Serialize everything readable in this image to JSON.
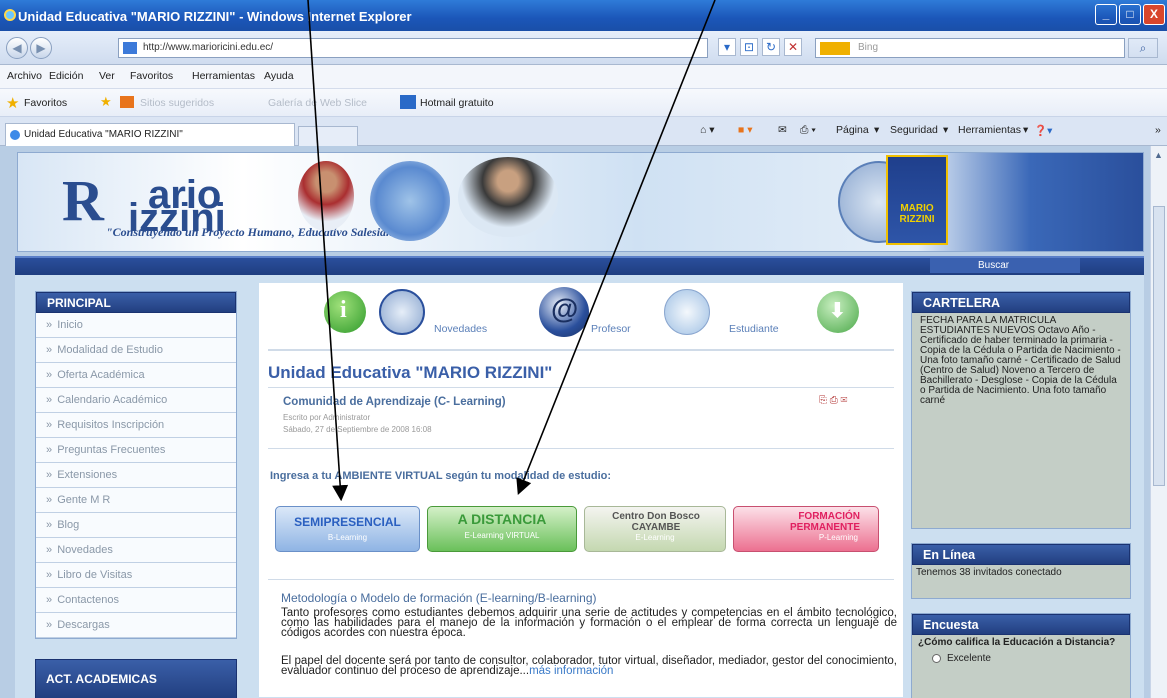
{
  "window": {
    "title": "Unidad Educativa \"MARIO RIZZINI\" - Windows Internet Explorer",
    "minimize": "_",
    "maximize": "□",
    "close": "X"
  },
  "address_bar": {
    "url": "http://www.marioricini.edu.ec/",
    "search_placeholder": "Bing"
  },
  "menu": [
    "Archivo",
    "Edición",
    "Ver",
    "Favoritos",
    "Herramientas",
    "Ayuda"
  ],
  "favorites_bar": {
    "favoritos": "Favoritos",
    "sitios": "Sitios sugeridos",
    "galeria": "Galería de Web Slice",
    "hotmail": "Hotmail gratuito"
  },
  "tab": {
    "title": "Unidad Educativa \"MARIO RIZZINI\""
  },
  "commands": {
    "pagina": "Página",
    "seguridad": "Seguridad",
    "herramientas": "Herramientas"
  },
  "banner": {
    "logo_r": "R",
    "logo_mario": "ario",
    "logo_izzini": "izzini",
    "slogan": "\"Construyendo un Proyecto Humano, Educativo Salesiano\"",
    "shield_text": "MARIO RIZZINI"
  },
  "nav": {
    "buscar": "Buscar"
  },
  "left_menu": {
    "header": "PRINCIPAL",
    "items": [
      "Inicio",
      "Modalidad de Estudio",
      "Oferta Académica",
      "Calendario Académico",
      "Requisitos Inscripción",
      "Preguntas Frecuentes",
      "Extensiones",
      "Gente M R",
      "Blog",
      "Novedades",
      "Libro de Visitas",
      "Contactenos",
      "Descargas"
    ],
    "act_header": "ACT. ACADEMICAS"
  },
  "top_icons": {
    "novedades": "Novedades",
    "profesor": "Profesor",
    "estudiante": "Estudiante"
  },
  "article": {
    "title": "Unidad Educativa \"MARIO RIZZINI\"",
    "subtitle": "Comunidad de Aprendizaje (C- Learning)",
    "author": "Escrito por Administrator",
    "date": "Sábado, 27 de Septiembre de 2008 16:08",
    "ingresa": "Ingresa a tu AMBIENTE VIRTUAL según tu modalidad de estudio:",
    "modalidades": [
      {
        "label": "SEMIPRESENCIAL",
        "sub": "B-Learning"
      },
      {
        "label": "A DISTANCIA",
        "sub": "E-Learning VIRTUAL"
      },
      {
        "label": "Centro Don Bosco CAYAMBE",
        "sub": "E-Learning"
      },
      {
        "label": "FORMACIÓN PERMANENTE",
        "sub": "P-Learning"
      }
    ],
    "metodologia": "Metodología o Modelo de formación (E-learning/B-learning)",
    "para1": "Tanto profesores como estudiantes debemos adquirir una serie de actitudes y competencias en el ámbito tecnológico, como las habilidades para el manejo de la información y formación o el emplear de forma correcta un lenguaje de códigos acordes con nuestra época.",
    "para2": "El papel del docente será por tanto de consultor, colaborador, tutor virtual, diseñador, mediador, gestor del conocimiento, evaluador continuo del proceso de aprendizaje...",
    "mas": "más información"
  },
  "right": {
    "cartelera_header": "CARTELERA",
    "cartelera_text": "FECHA PARA LA MATRICULA ESTUDIANTES NUEVOS Octavo Año - Certificado de haber terminado la primaria - Copia de la Cédula o Partida de Nacimiento - Una foto tamaño carné - Certificado de Salud (Centro de Salud) Noveno a Tercero de Bachillerato - Desglose - Copia de la Cédula o Partida de Nacimiento. Una foto tamaño carné",
    "enlinea_header": "En Línea",
    "enlinea_text": "Tenemos 38 invitados conectado",
    "encuesta_header": "Encuesta",
    "encuesta_q": "¿Cómo califica la Educación a Distancia?",
    "encuesta_opt": "Excelente"
  }
}
